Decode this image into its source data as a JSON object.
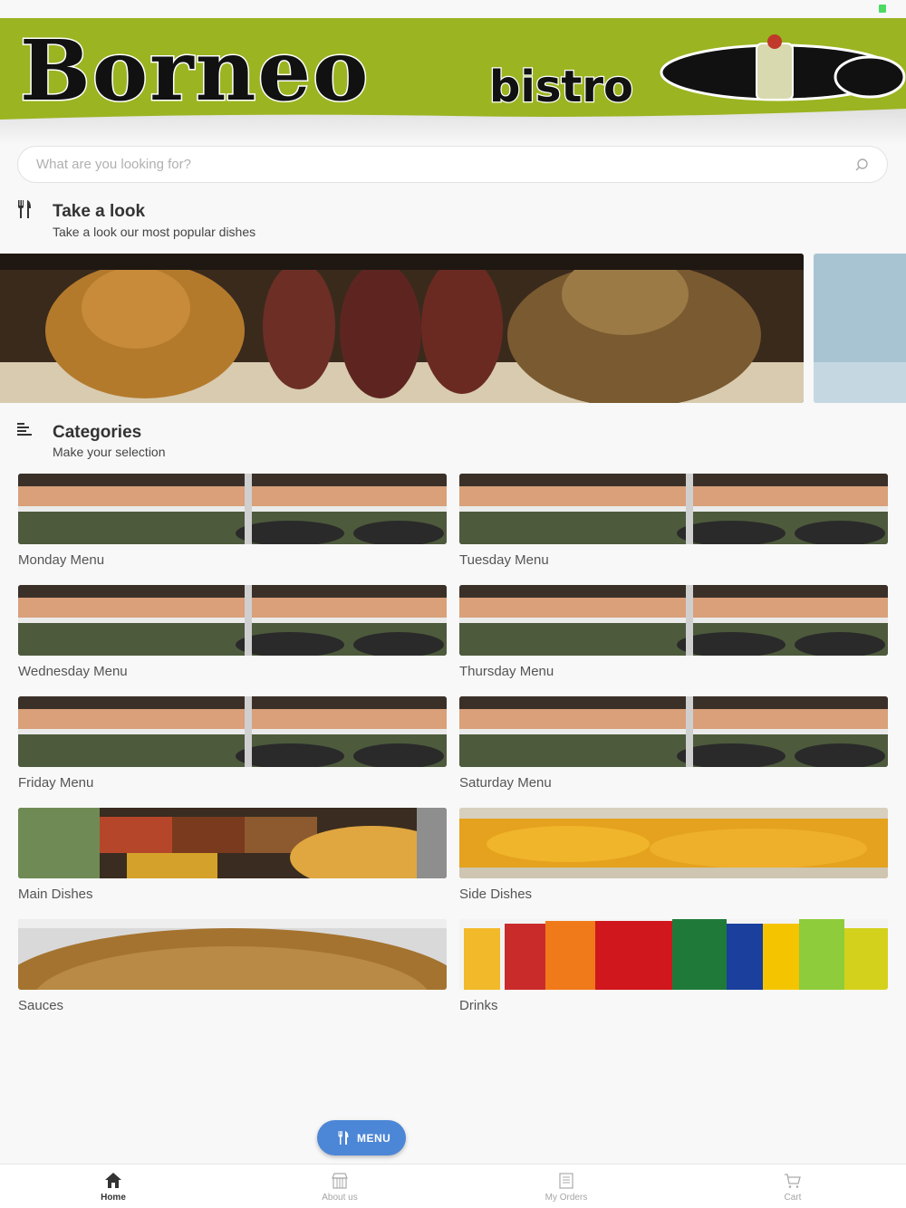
{
  "app": {
    "brand_primary": "Borneo",
    "brand_secondary": "bistro",
    "brand_color": "#9bb421",
    "accent_color": "#4c86d6"
  },
  "search": {
    "placeholder": "What are you looking for?",
    "value": "",
    "icon": "search-icon"
  },
  "featured": {
    "icon": "utensils-icon",
    "title": "Take a look",
    "subtitle": "Take a look our most popular dishes"
  },
  "categories_section": {
    "icon": "list-icon",
    "title": "Categories",
    "subtitle": "Make your selection",
    "items": [
      {
        "label": "Monday Menu"
      },
      {
        "label": "Tuesday Menu"
      },
      {
        "label": "Wednesday Menu"
      },
      {
        "label": "Thursday Menu"
      },
      {
        "label": "Friday Menu"
      },
      {
        "label": "Saturday Menu"
      },
      {
        "label": "Main Dishes"
      },
      {
        "label": "Side Dishes"
      },
      {
        "label": "Sauces"
      },
      {
        "label": "Drinks"
      }
    ]
  },
  "fab": {
    "label": "MENU",
    "icon": "utensils-icon"
  },
  "tabbar": {
    "active": "Home",
    "items": [
      {
        "label": "Home",
        "icon": "home-icon"
      },
      {
        "label": "About us",
        "icon": "store-icon"
      },
      {
        "label": "My Orders",
        "icon": "orders-icon"
      },
      {
        "label": "Cart",
        "icon": "cart-icon"
      }
    ]
  }
}
